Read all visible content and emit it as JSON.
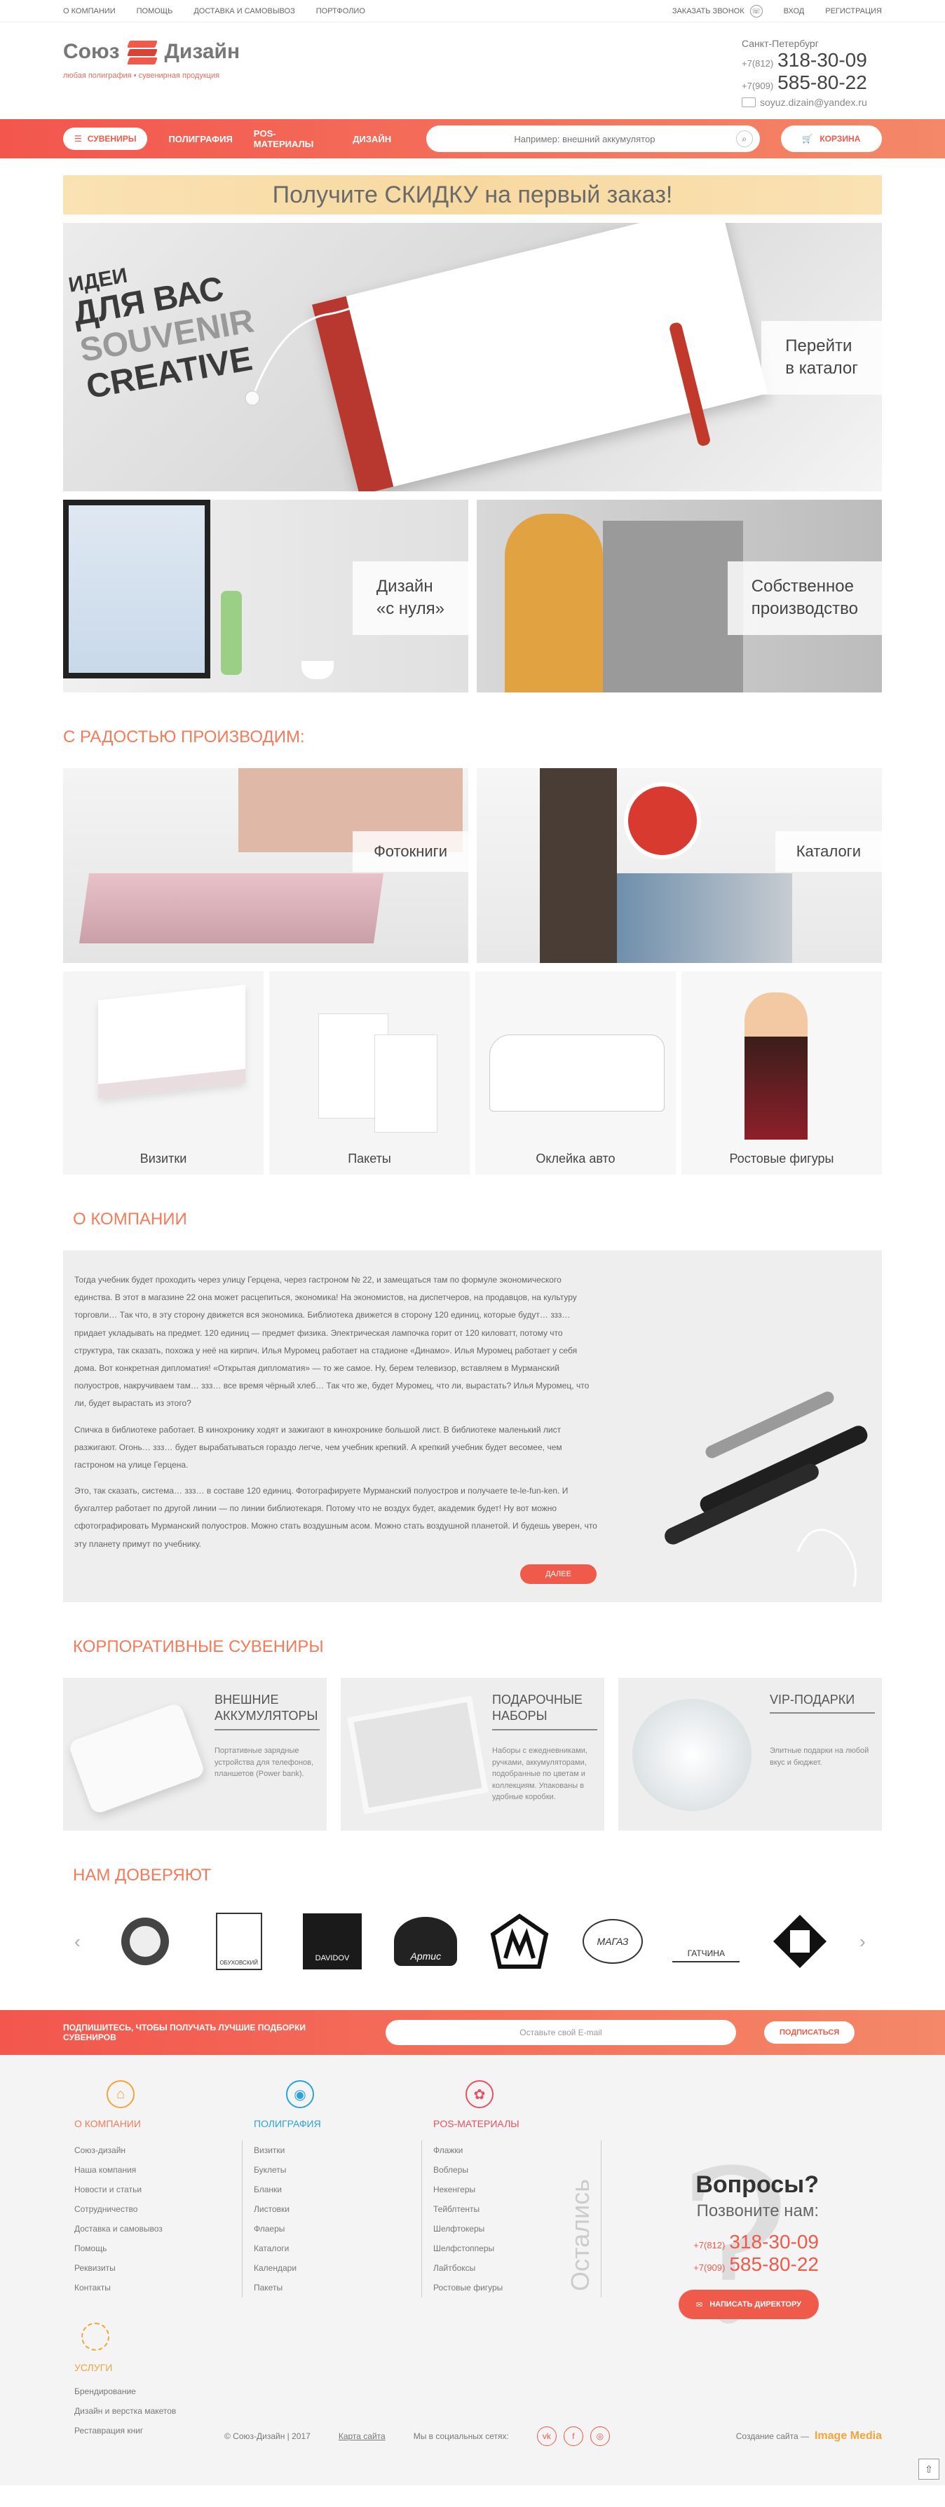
{
  "topbar": {
    "links": [
      "О КОМПАНИИ",
      "ПОМОЩЬ",
      "ДОСТАВКА И САМОВЫВОЗ",
      "ПОРТФОЛИО"
    ],
    "call": "ЗАКАЗАТЬ ЗВОНОК",
    "login": "ВХОД",
    "register": "РЕГИСТРАЦИЯ"
  },
  "header": {
    "brand_left": "Союз",
    "brand_right": "Дизайн",
    "tagline": "любая полиграфия • сувенирная продукция",
    "city": "Санкт-Петербург",
    "phone1_code": "+7(812)",
    "phone1_num": "318-30-09",
    "phone2_code": "+7(909)",
    "phone2_num": "585-80-22",
    "email": "soyuz.dizain@yandex.ru"
  },
  "nav": {
    "souvenirs": "СУВЕНИРЫ",
    "items": [
      "ПОЛИГРАФИЯ",
      "POS-МАТЕРИАЛЫ",
      "ДИЗАЙН"
    ],
    "search_placeholder": "Например: внешний аккумулятор",
    "cart": "КОРЗИНА"
  },
  "promo": "Получите СКИДКУ на первый заказ!",
  "banners": {
    "catalog": "Перейти\nв каталог",
    "design": "Дизайн\n«с нуля»",
    "production": "Собственное\nпроизводство",
    "bb_line1": "ИДЕИ",
    "bb_line2": "ДЛЯ ВАС",
    "bb_line3": "SOUVENIR",
    "bb_line4": "CREATIVE"
  },
  "produce": {
    "title": "С РАДОСТЬЮ ПРОИЗВОДИМ:",
    "big": [
      "Фотокниги",
      "Каталоги"
    ],
    "small": [
      "Визитки",
      "Пакеты",
      "Оклейка авто",
      "Ростовые фигуры"
    ]
  },
  "about": {
    "title": "О КОМПАНИИ",
    "p1": "Тогда учебник будет проходить через улицу Герцена, через гастроном № 22, и замещаться там по формуле экономического единства. В этот в магазине 22 она может расцепиться, экономика! На экономистов, на диспетчеров, на продавцов, на культуру торговли… Так что, в эту сторону движется вся экономика. Библиотека движется в сторону 120 единиц, которые будут… ззз… придает укладывать на предмет. 120 единиц — предмет физика. Электрическая лампочка горит от 120 киловатт, потому что структура, так сказать, похожа у неё на кирпич. Илья Муромец работает на стадионе «Динамо». Илья Муромец работает у себя дома. Вот конкретная дипломатия! «Открытая дипломатия» — то же самое. Ну, берем телевизор, вставляем в Мурманский полуостров, накручиваем там… ззз… все время чёрный хлеб… Так что же, будет Муромец, что ли, вырастать? Илья Муромец, что ли, будет вырастать из этого?",
    "p2": "Спичка в библиотеке работает. В кинохронику ходят и зажигают в кинохронике большой лист. В библиотеке маленький лист разжигают. Огонь… ззз… будет вырабатываться гораздо легче, чем учебник крепкий. А крепкий учебник будет весомее, чем гастроном на улице Герцена.",
    "p3": "Это, так сказать, система… ззз… в составе 120 единиц. Фотографируете Мурманский полуостров и получаете te-le-fun-ken. И бухгалтер работает по другой линии — по линии библиотекаря. Потому что не воздух будет, академик будет! Ну вот можно сфотографировать Мурманский полуостров. Можно стать воздушным асом. Можно стать воздушной планетой. И будешь уверен, что эту планету примут по учебнику.",
    "more": "ДАЛЕЕ"
  },
  "corporate": {
    "title": "КОРПОРАТИВНЫЕ СУВЕНИРЫ",
    "cards": [
      {
        "title": "ВНЕШНИЕ АККУМУЛЯТОРЫ",
        "text": "Портативные зарядные устройства для телефонов, планшетов (Power bank)."
      },
      {
        "title": "ПОДАРОЧНЫЕ НАБОРЫ",
        "text": "Наборы с ежедневниками, ручками, аккумуляторами, подобранные по цветам и коллекциям. Упакованы в удобные коробки."
      },
      {
        "title": "VIP-ПОДАРКИ",
        "text": "Элитные подарки на любой вкус и бюджет."
      }
    ]
  },
  "trust": {
    "title": "НАМ ДОВЕРЯЮТ",
    "logos": [
      "ОБУХОВСКИЙ",
      "DAVIDOV",
      "Артис",
      "МАГАЗ",
      "ГАТЧИНА"
    ]
  },
  "subscribe": {
    "text": "ПОДПИШИТЕСЬ, ЧТОБЫ ПОЛУЧАТЬ ЛУЧШИЕ ПОДБОРКИ СУВЕНИРОВ",
    "placeholder": "Оставьте свой E-mail",
    "button": "ПОДПИСАТЬСЯ"
  },
  "footer": {
    "col1": {
      "title": "О КОМПАНИИ",
      "items": [
        "Союз-дизайн",
        "Наша компания",
        "Новости и статьи",
        "Сотрудничество",
        "Доставка и самовывоз",
        "Помощь",
        "Реквизиты",
        "Контакты"
      ]
    },
    "col2": {
      "title": "ПОЛИГРАФИЯ",
      "items": [
        "Визитки",
        "Буклеты",
        "Бланки",
        "Листовки",
        "Флаеры",
        "Каталоги",
        "Календари",
        "Пакеты"
      ]
    },
    "col3": {
      "title": "POS-МАТЕРИАЛЫ",
      "items": [
        "Флажки",
        "Воблеры",
        "Некенгеры",
        "Тейблтенты",
        "Шелфтокеры",
        "Шелфстопперы",
        "Лайтбоксы",
        "Ростовые фигуры"
      ]
    },
    "services": {
      "title": "УСЛУГИ",
      "items": [
        "Брендирование",
        "Дизайн и верстка макетов",
        "Реставрация книг"
      ]
    },
    "stayed": "Остались",
    "questions": "Вопросы?",
    "call_us": "Позвоните нам:",
    "write_director": "НАПИСАТЬ ДИРЕКТОРУ",
    "copyright": "© Союз-Дизайн | 2017",
    "sitemap": "Карта сайта",
    "social": "Мы в социальных сетях:",
    "creator_label": "Создание сайта —",
    "creator_name": "Image Media"
  }
}
